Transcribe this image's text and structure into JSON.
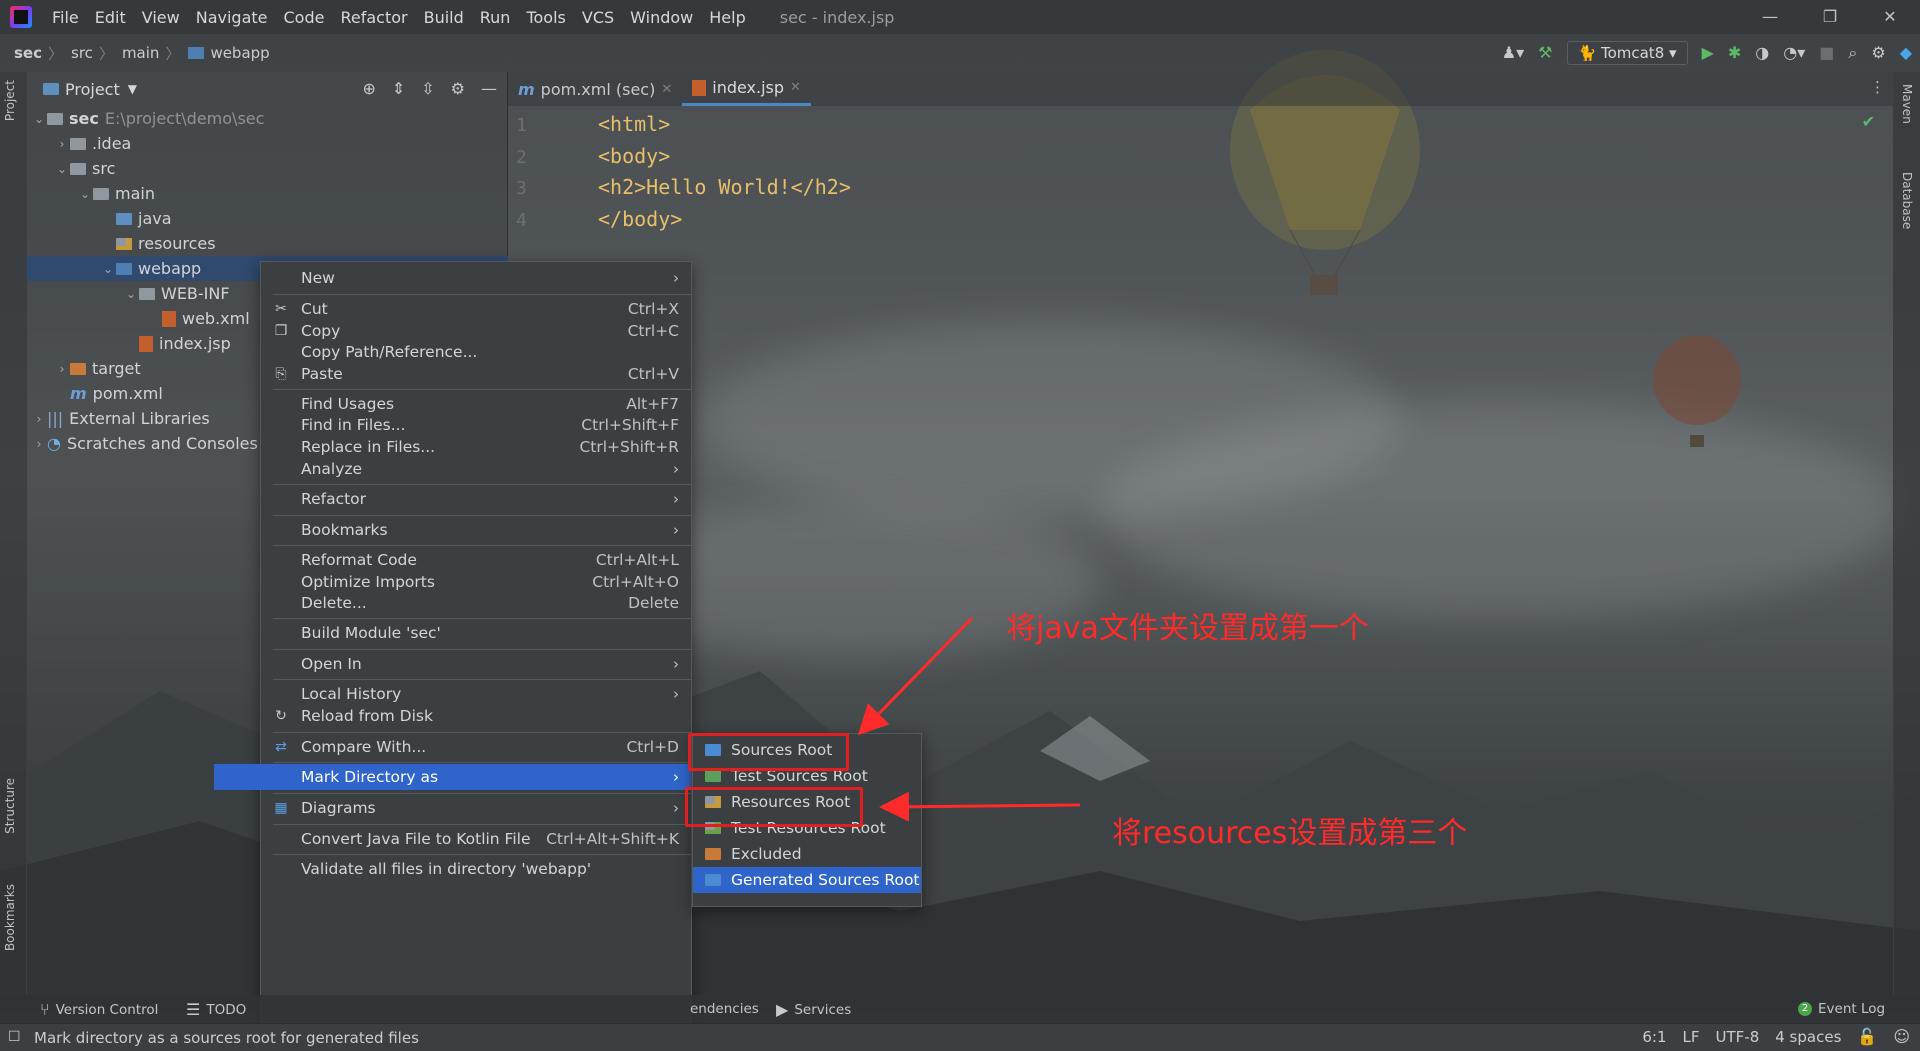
{
  "window": {
    "title": "sec - index.jsp",
    "menu": [
      "File",
      "Edit",
      "View",
      "Navigate",
      "Code",
      "Refactor",
      "Build",
      "Run",
      "Tools",
      "VCS",
      "Window",
      "Help"
    ],
    "controls": {
      "minimize": "—",
      "restore": "❐",
      "close": "✕"
    }
  },
  "breadcrumb": {
    "items": [
      "sec",
      "src",
      "main",
      "webapp"
    ]
  },
  "toolbar": {
    "run_config": "Tomcat8"
  },
  "tool_strips": {
    "project": "Project",
    "structure": "Structure",
    "bookmarks": "Bookmarks",
    "maven": "Maven",
    "database": "Database"
  },
  "project_panel": {
    "title": "Project",
    "tree": [
      {
        "label": "sec",
        "hint": "E:\\project\\demo\\sec",
        "arrow": "⌄",
        "icon": "module-folder-icon"
      },
      {
        "label": ".idea",
        "arrow": "›",
        "icon": "folder-icon"
      },
      {
        "label": "src",
        "arrow": "⌄",
        "icon": "folder-icon"
      },
      {
        "label": "main",
        "arrow": "⌄",
        "icon": "folder-icon"
      },
      {
        "label": "java",
        "arrow": "",
        "icon": "source-folder-icon"
      },
      {
        "label": "resources",
        "arrow": "",
        "icon": "resources-folder-icon"
      },
      {
        "label": "webapp",
        "arrow": "⌄",
        "icon": "web-folder-icon"
      },
      {
        "label": "WEB-INF",
        "arrow": "⌄",
        "icon": "folder-icon"
      },
      {
        "label": "web.xml",
        "arrow": "",
        "icon": "xml-file-icon"
      },
      {
        "label": "index.jsp",
        "arrow": "",
        "icon": "jsp-file-icon"
      },
      {
        "label": "target",
        "arrow": "›",
        "icon": "excluded-folder-icon"
      },
      {
        "label": "pom.xml",
        "arrow": "",
        "icon": "maven-file-icon"
      },
      {
        "label": "External Libraries",
        "arrow": "›",
        "icon": "library-icon"
      },
      {
        "label": "Scratches and Consoles",
        "arrow": "›",
        "icon": "scratches-icon"
      }
    ]
  },
  "editor": {
    "tabs": [
      {
        "label": "pom.xml (sec)",
        "active": false
      },
      {
        "label": "index.jsp",
        "active": true
      }
    ],
    "lines": [
      {
        "num": "1",
        "code": "<html>"
      },
      {
        "num": "2",
        "code": "<body>"
      },
      {
        "num": "3",
        "code": "<h2>Hello World!</h2>"
      },
      {
        "num": "4",
        "code": "</body>"
      }
    ]
  },
  "context_menu": {
    "items": [
      {
        "label": "New",
        "shortcut": "",
        "submenu": true
      },
      {
        "label": "Cut",
        "shortcut": "Ctrl+X",
        "icon": "✂"
      },
      {
        "label": "Copy",
        "shortcut": "Ctrl+C",
        "icon": "❐"
      },
      {
        "label": "Copy Path/Reference...",
        "shortcut": ""
      },
      {
        "label": "Paste",
        "shortcut": "Ctrl+V",
        "icon": "⎘"
      },
      {
        "label": "Find Usages",
        "shortcut": "Alt+F7"
      },
      {
        "label": "Find in Files...",
        "shortcut": "Ctrl+Shift+F"
      },
      {
        "label": "Replace in Files...",
        "shortcut": "Ctrl+Shift+R"
      },
      {
        "label": "Analyze",
        "shortcut": "",
        "submenu": true
      },
      {
        "label": "Refactor",
        "shortcut": "",
        "submenu": true
      },
      {
        "label": "Bookmarks",
        "shortcut": "",
        "submenu": true
      },
      {
        "label": "Reformat Code",
        "shortcut": "Ctrl+Alt+L"
      },
      {
        "label": "Optimize Imports",
        "shortcut": "Ctrl+Alt+O"
      },
      {
        "label": "Delete...",
        "shortcut": "Delete"
      },
      {
        "label": "Build Module 'sec'",
        "shortcut": ""
      },
      {
        "label": "Open In",
        "shortcut": "",
        "submenu": true
      },
      {
        "label": "Local History",
        "shortcut": "",
        "submenu": true
      },
      {
        "label": "Reload from Disk",
        "shortcut": "",
        "icon": "↻"
      },
      {
        "label": "Compare With...",
        "shortcut": "Ctrl+D",
        "icon": "⇄"
      },
      {
        "label": "Mark Directory as",
        "shortcut": "",
        "submenu": true,
        "highlighted": true
      },
      {
        "label": "Diagrams",
        "shortcut": "",
        "submenu": true,
        "icon": "▦"
      },
      {
        "label": "Convert Java File to Kotlin File",
        "shortcut": "Ctrl+Alt+Shift+K"
      },
      {
        "label": "Validate all files in directory 'webapp'",
        "shortcut": ""
      }
    ]
  },
  "mark_directory_submenu": {
    "items": [
      {
        "label": "Sources Root"
      },
      {
        "label": "Test Sources Root"
      },
      {
        "label": "Resources Root"
      },
      {
        "label": "Test Resources Root"
      },
      {
        "label": "Excluded"
      },
      {
        "label": "Generated Sources Root",
        "highlighted": true
      }
    ]
  },
  "annotations": {
    "note1": "将java文件夹设置成第一个",
    "note2": "将resources设置成第三个",
    "color": "#ff2a2a"
  },
  "bottom_tools": {
    "version_control": "Version Control",
    "todo": "TODO",
    "dependencies": "endencies",
    "services": "Services",
    "event_log": "Event Log",
    "event_count": "2"
  },
  "status": {
    "message": "Mark directory as a sources root for generated files",
    "position": "6:1",
    "line_sep": "LF",
    "encoding": "UTF-8",
    "indent": "4 spaces"
  }
}
